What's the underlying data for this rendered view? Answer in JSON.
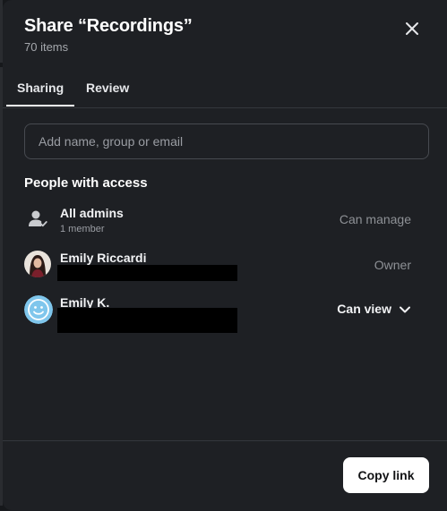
{
  "dialog": {
    "title": "Share “Recordings”",
    "subtitle": "70 items",
    "close_icon": "close-icon"
  },
  "tabs": [
    {
      "label": "Sharing",
      "active": true
    },
    {
      "label": "Review",
      "active": false
    }
  ],
  "search": {
    "placeholder": "Add name, group or email",
    "value": ""
  },
  "access": {
    "section_title": "People with access",
    "entries": [
      {
        "name": "All admins",
        "detail": "1 member",
        "role": "Can manage",
        "icon": "group-check-icon"
      },
      {
        "name": "Emily Riccardi",
        "detail": "",
        "role": "Owner",
        "icon": "avatar-photo"
      },
      {
        "name": "Emily K.",
        "detail": "",
        "role": "Can view",
        "icon": "smiley-avatar-icon"
      }
    ]
  },
  "footer": {
    "copy_link_label": "Copy link"
  },
  "colors": {
    "dialog_bg": "#1e2024",
    "primary_text": "#f2f3f5",
    "muted_text": "#9a9da3",
    "button_bg": "#ffffff",
    "smiley_avatar": "#7fc6ec"
  }
}
